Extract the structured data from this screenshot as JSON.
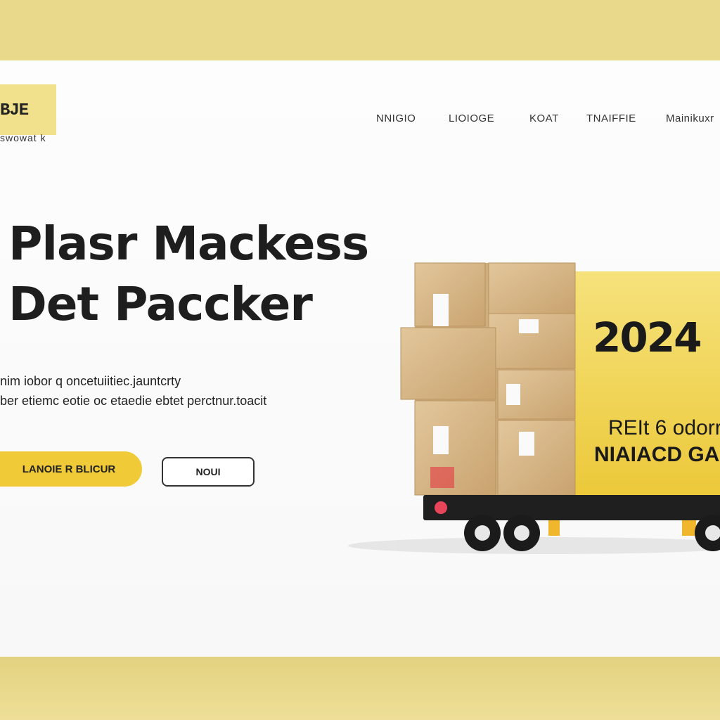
{
  "brand": {
    "logo_text": "BJE",
    "tagline": "swowat k"
  },
  "nav": {
    "items": [
      {
        "label": "NNIGIO"
      },
      {
        "label": "LIOIOGE"
      },
      {
        "label": "KOAT"
      },
      {
        "label": "TNAIFFIE"
      },
      {
        "label": "Mainikuxr"
      }
    ]
  },
  "hero": {
    "title_line1": "Plasr Mackess",
    "title_line2": "Det Paccker",
    "desc_line1": "nim iobor q oncetuiitiec.jauntcrty",
    "desc_line2": "ber etiemc eotie oc etaedie ebtet perctnur.toacit",
    "primary_button": "LANOIE R BLICUR",
    "secondary_button": "NOUI"
  },
  "truck_ad": {
    "year": "2024",
    "line1": "REIt 6 odorr",
    "line2": "NIAIACD GA"
  },
  "colors": {
    "accent": "#f1cb37",
    "panel_yellow": "#f3d95e",
    "band": "#e9d98a",
    "box": "#d9b98a",
    "text": "#1e1e1e"
  }
}
